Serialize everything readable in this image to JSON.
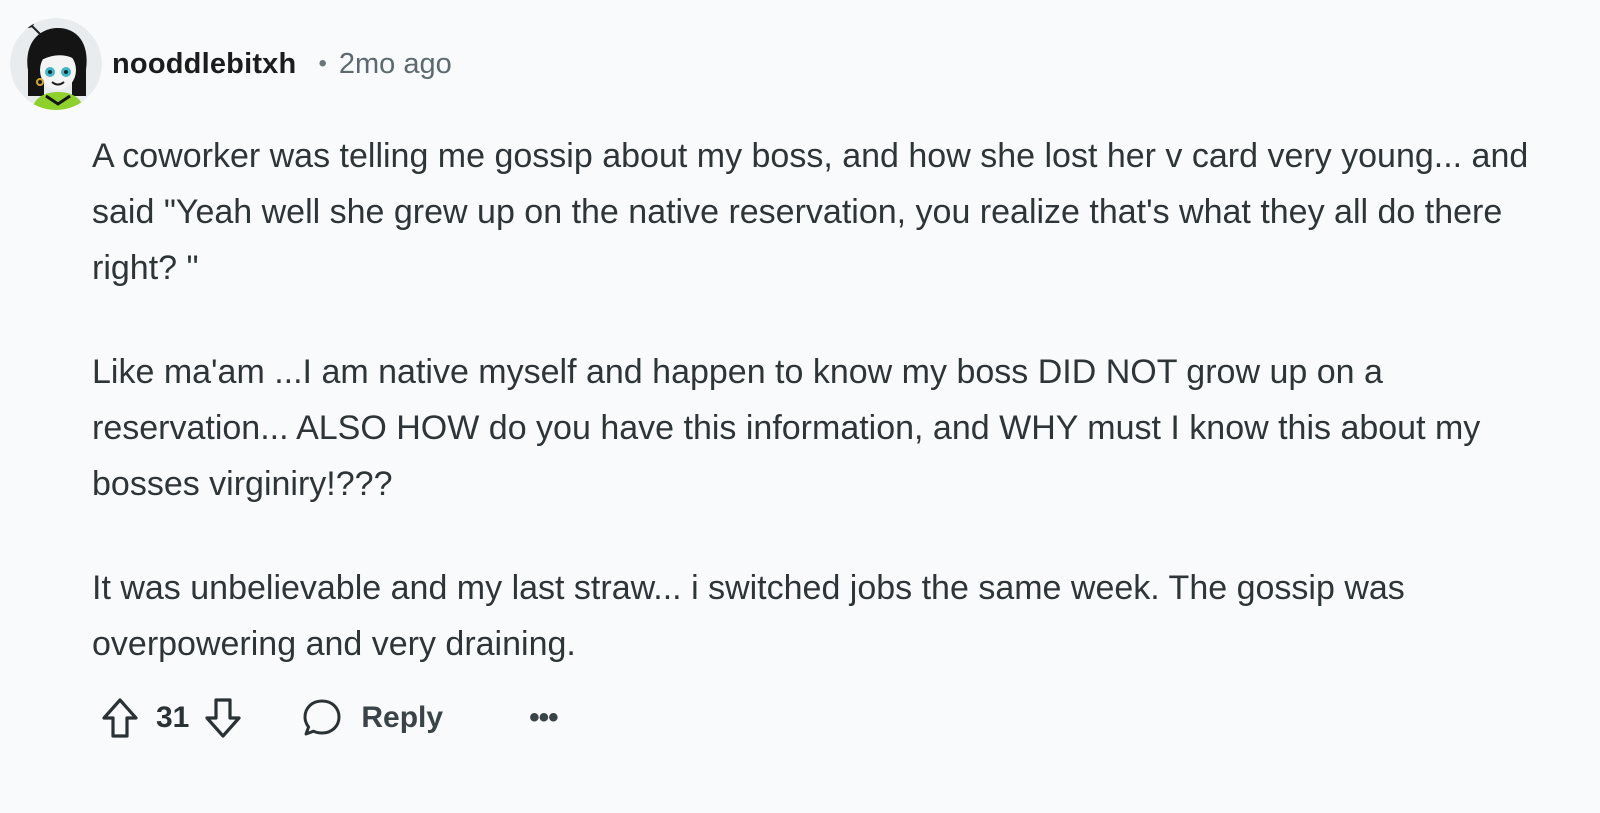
{
  "comment": {
    "author": "nooddlebitxh",
    "separator": "•",
    "time_ago": "2mo ago",
    "paragraphs": [
      "A coworker was telling me gossip about my boss, and how she lost her v card very young... and said \"Yeah well she grew up on the native reservation, you realize that's what they all do there right? \"",
      "Like ma'am ...I am native myself and happen to know my boss DID NOT grow up on a reservation... ALSO HOW do you have this information, and WHY must I know this about my bosses virginiry!???",
      "It was unbelievable and my last straw... i switched jobs the same week. The gossip was overpowering and very draining."
    ],
    "score": "31",
    "reply_label": "Reply",
    "more_label": "•••"
  },
  "icons": {
    "avatar": "avatar",
    "upvote": "upvote-icon",
    "downvote": "downvote-icon",
    "reply": "comment-bubble-icon",
    "more": "more-options-icon"
  },
  "colors": {
    "background": "#f9fafb",
    "text": "#2e3538",
    "muted": "#5c6a70"
  }
}
